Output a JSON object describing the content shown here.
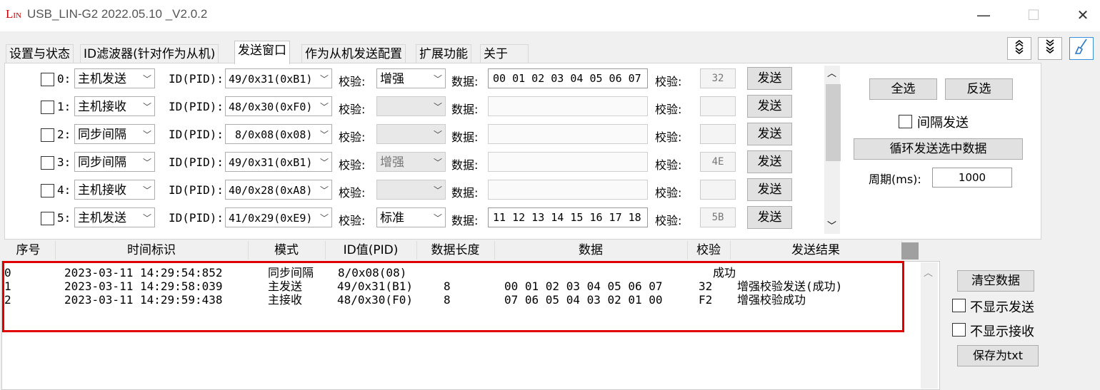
{
  "window": {
    "logo_main": "L",
    "logo_sub": "IN",
    "title": "USB_LIN-G2 2022.05.10 _V2.0.2",
    "minimize_glyph": "—",
    "maximize_glyph": "☐",
    "close_glyph": "✕"
  },
  "tabs": [
    {
      "label": "设置与状态"
    },
    {
      "label": "ID滤波器(针对作为从机)"
    },
    {
      "label": "发送窗口"
    },
    {
      "label": "作为从机发送配置"
    },
    {
      "label": "扩展功能"
    },
    {
      "label": "关于"
    }
  ],
  "toolbar_icons": [
    "expand-icon",
    "collapse-icon",
    "brush-icon"
  ],
  "send_rows": [
    {
      "index": "0:",
      "mode": "主机发送",
      "id_label": "ID(PID):",
      "id": "49/0x31(0xB1)",
      "check_label": "校验:",
      "check_type": "增强",
      "check_enabled": true,
      "data_label": "数据:",
      "data": "00 01 02 03 04 05 06 07",
      "data_enabled": true,
      "sum_label": "校验:",
      "checksum": "32",
      "send": "发送"
    },
    {
      "index": "1:",
      "mode": "主机接收",
      "id_label": "ID(PID):",
      "id": "48/0x30(0xF0)",
      "check_label": "校验:",
      "check_type": "",
      "check_enabled": false,
      "data_label": "数据:",
      "data": "",
      "data_enabled": false,
      "sum_label": "校验:",
      "checksum": "",
      "send": "发送"
    },
    {
      "index": "2:",
      "mode": "同步间隔",
      "id_label": "ID(PID):",
      "id": " 8/0x08(0x08)",
      "check_label": "校验:",
      "check_type": "",
      "check_enabled": false,
      "data_label": "数据:",
      "data": "",
      "data_enabled": false,
      "sum_label": "校验:",
      "checksum": "",
      "send": "发送"
    },
    {
      "index": "3:",
      "mode": "同步间隔",
      "id_label": "ID(PID):",
      "id": "49/0x31(0xB1)",
      "check_label": "校验:",
      "check_type": "增强",
      "check_enabled": false,
      "data_label": "数据:",
      "data": "",
      "data_enabled": false,
      "sum_label": "校验:",
      "checksum": "4E",
      "send": "发送"
    },
    {
      "index": "4:",
      "mode": "主机接收",
      "id_label": "ID(PID):",
      "id": "40/0x28(0xA8)",
      "check_label": "校验:",
      "check_type": "",
      "check_enabled": false,
      "data_label": "数据:",
      "data": "",
      "data_enabled": false,
      "sum_label": "校验:",
      "checksum": "",
      "send": "发送"
    },
    {
      "index": "5:",
      "mode": "主机发送",
      "id_label": "ID(PID):",
      "id": "41/0x29(0xE9)",
      "check_label": "校验:",
      "check_type": "标准",
      "check_enabled": true,
      "data_label": "数据:",
      "data": "11 12 13 14 15 16 17 18",
      "data_enabled": true,
      "sum_label": "校验:",
      "checksum": "5B",
      "send": "发送"
    }
  ],
  "right_panel": {
    "select_all": "全选",
    "invert": "反选",
    "interval_send": "间隔发送",
    "loop_send": "循环发送选中数据",
    "period_label": "周期(ms):",
    "period_value": "1000"
  },
  "log": {
    "columns": [
      "序号",
      "时间标识",
      "模式",
      "ID值(PID)",
      "数据长度",
      "数据",
      "校验",
      "发送结果"
    ],
    "rows": [
      {
        "seq": "0",
        "time": "2023-03-11 14:29:54:852",
        "mode": "同步间隔",
        "id": "8/0x08(08)",
        "len": "",
        "data": "",
        "sum": "",
        "result": "成功"
      },
      {
        "seq": "1",
        "time": "2023-03-11 14:29:58:039",
        "mode": "主发送",
        "id": "49/0x31(B1)",
        "len": "8",
        "data": "00 01 02 03 04 05 06 07",
        "sum": "32",
        "result": "增强校验发送(成功)"
      },
      {
        "seq": "2",
        "time": "2023-03-11 14:29:59:438",
        "mode": "主接收",
        "id": "48/0x30(F0)",
        "len": "8",
        "data": "07 06 05 04 03 02 01 00",
        "sum": "F2",
        "result": "增强校验成功"
      }
    ],
    "clear": "清空数据",
    "hide_send": "不显示发送",
    "hide_recv": "不显示接收",
    "save_txt": "保存为txt"
  },
  "colors": {
    "highlight_box": "#e00000",
    "logo": "#c00000"
  }
}
